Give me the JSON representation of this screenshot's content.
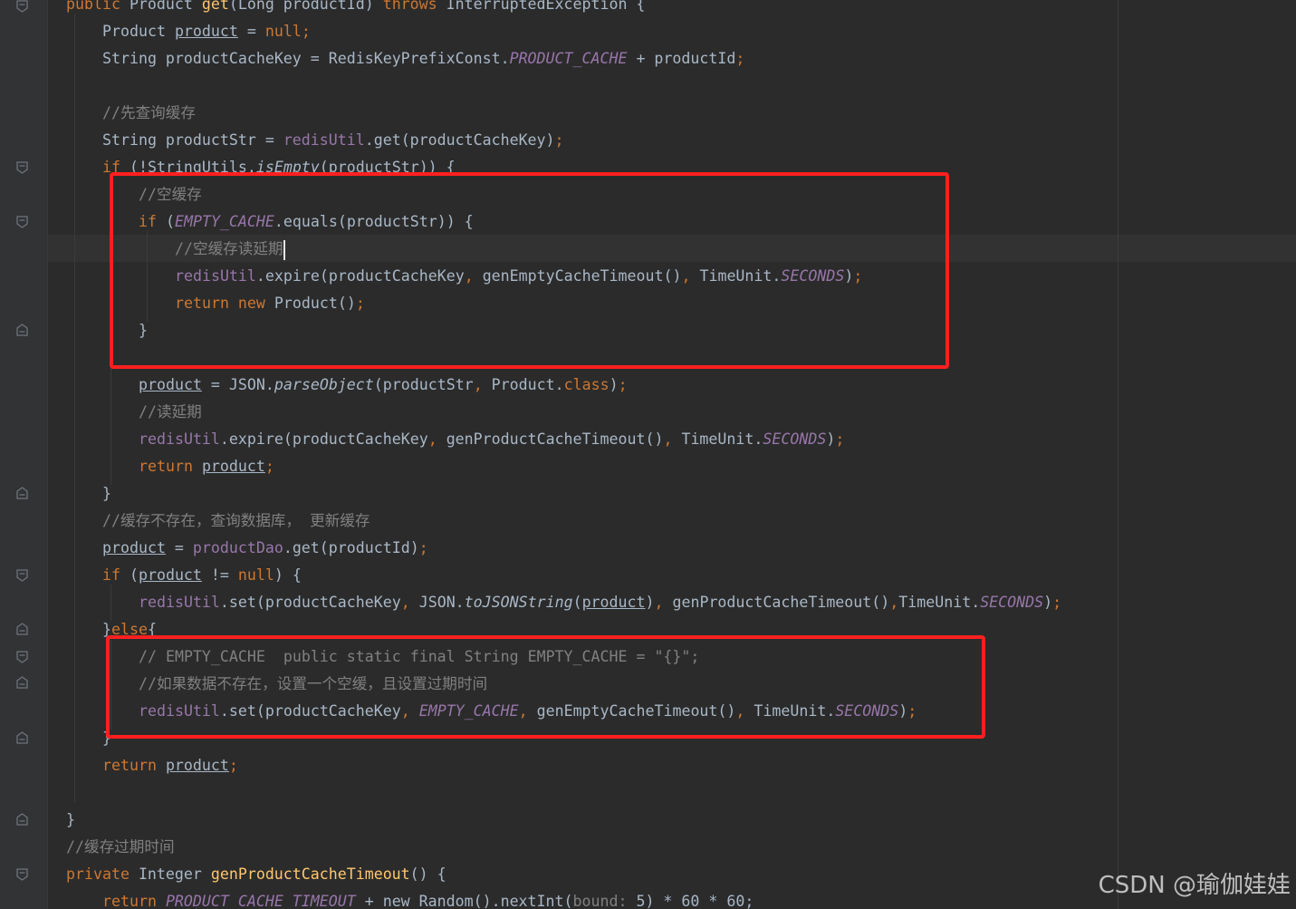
{
  "editor": {
    "colors": {
      "background": "#2b2b2b",
      "keyword": "#cc7832",
      "comment": "#808080",
      "field": "#9876aa",
      "method": "#ffc66d",
      "text": "#a9b7c6",
      "highlight_box": "#ff1f1f"
    },
    "code": {
      "l0": {
        "a": "public ",
        "b": "Product ",
        "c": "get",
        "d": "(Long productId) ",
        "e": "throws ",
        "f": "InterruptedException {"
      },
      "l1": {
        "a": "Product ",
        "b": "product",
        "c": " = ",
        "d": "null",
        "e": ";"
      },
      "l2": {
        "a": "String productCacheKey = RedisKeyPrefixConst.",
        "b": "PRODUCT_CACHE",
        "c": " + productId",
        "d": ";"
      },
      "l4": {
        "a": "//先查询缓存"
      },
      "l5": {
        "a": "String productStr = ",
        "b": "redisUtil",
        "c": ".get(productCacheKey)",
        "d": ";"
      },
      "l6": {
        "a": "if ",
        "b": "(!StringUtils.",
        "c": "isEmpty",
        "d": "(productStr)) {"
      },
      "l7": {
        "a": "//空缓存"
      },
      "l8": {
        "a": "if ",
        "b": "(",
        "c": "EMPTY_CACHE",
        "d": ".equals(productStr)) {"
      },
      "l9": {
        "a": "//空缓存读延期"
      },
      "l10": {
        "a": "redisUtil",
        "b": ".expire(productCacheKey",
        "c": ", ",
        "d": "genEmptyCacheTimeout()",
        "e": ", ",
        "f": "TimeUnit.",
        "g": "SECONDS",
        "h": ")",
        "i": ";"
      },
      "l11": {
        "a": "return new ",
        "b": "Product()",
        "c": ";"
      },
      "l12": {
        "a": "}"
      },
      "l14": {
        "a": "product",
        "b": " = JSON.",
        "c": "parseObject",
        "d": "(productStr",
        "e": ", ",
        "f": "Product.",
        "g": "class",
        "h": ")",
        "i": ";"
      },
      "l15": {
        "a": "//读延期"
      },
      "l16": {
        "a": "redisUtil",
        "b": ".expire(productCacheKey",
        "c": ", ",
        "d": "genProductCacheTimeout()",
        "e": ", ",
        "f": "TimeUnit.",
        "g": "SECONDS",
        "h": ")",
        "i": ";"
      },
      "l17": {
        "a": "return ",
        "b": "product",
        "c": ";"
      },
      "l18": {
        "a": "}"
      },
      "l19": {
        "a": "//缓存不存在，查询数据库， 更新缓存"
      },
      "l20": {
        "a": "product",
        "b": " = ",
        "c": "productDao",
        "d": ".get(productId)",
        "e": ";"
      },
      "l21": {
        "a": "if ",
        "b": "(",
        "c": "product",
        "d": " != ",
        "e": "null",
        "f": ") {"
      },
      "l22": {
        "a": "redisUtil",
        "b": ".set(productCacheKey",
        "c": ", ",
        "d": "JSON.",
        "e": "toJSONString",
        "f": "(",
        "g": "product",
        "h": ")",
        "i": ", ",
        "j": "genProductCacheTimeout()",
        "k": ",",
        "l": "TimeUnit.",
        "m": "SECONDS",
        "n": ")",
        "o": ";"
      },
      "l23": {
        "a": "}",
        "b": "else",
        "c": "{"
      },
      "l24": {
        "a": "// EMPTY_CACHE  public static final String EMPTY_CACHE = \"{}\";"
      },
      "l25": {
        "a": "//如果数据不存在，设置一个空缓，且设置过期时间"
      },
      "l26": {
        "a": "redisUtil",
        "b": ".set(productCacheKey",
        "c": ", ",
        "d": "EMPTY_CACHE",
        "e": ", ",
        "f": "genEmptyCacheTimeout()",
        "g": ", ",
        "h": "TimeUnit.",
        "i": "SECONDS",
        "j": ")",
        "k": ";"
      },
      "l27": {
        "a": "}"
      },
      "l28": {
        "a": "return ",
        "b": "product",
        "c": ";"
      },
      "l30": {
        "a": "}"
      },
      "l31": {
        "a": "//缓存过期时间"
      },
      "l32": {
        "a": "private ",
        "b": "Integer ",
        "c": "genProductCacheTimeout",
        "d": "() {"
      },
      "l33": {
        "a": "return ",
        "b": "PRODUCT_CACHE_TIMEOUT",
        "c": " + new Random().nextInt(",
        "d": "bound: ",
        "e": "5) * 60 * 60;"
      }
    }
  },
  "watermark": "CSDN @瑜伽娃娃"
}
